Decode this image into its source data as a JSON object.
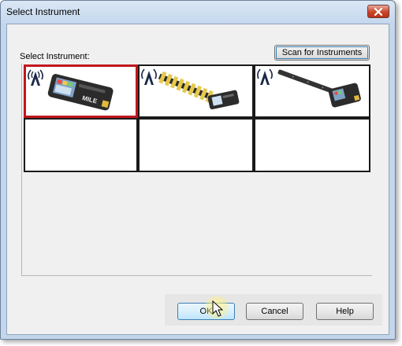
{
  "window": {
    "title": "Select Instrument"
  },
  "dialog": {
    "select_label": "Select Instrument:",
    "scan_button": "Scan for Instruments"
  },
  "buttons": {
    "ok": "OK",
    "cancel": "Cancel",
    "help": "Help"
  },
  "instruments": [
    {
      "slot": 1,
      "icon": "handheld-meter-device",
      "selected": true
    },
    {
      "slot": 2,
      "icon": "sensor-probe-array-device",
      "selected": false
    },
    {
      "slot": 3,
      "icon": "long-probe-meter-device",
      "selected": false
    },
    {
      "slot": 4,
      "icon": "empty-slot",
      "selected": false
    },
    {
      "slot": 5,
      "icon": "empty-slot",
      "selected": false
    },
    {
      "slot": 6,
      "icon": "empty-slot",
      "selected": false
    }
  ],
  "colors": {
    "selection_border": "#c0171c",
    "dialog_background": "#f0f0f0",
    "frame": "#c3d6ec"
  }
}
